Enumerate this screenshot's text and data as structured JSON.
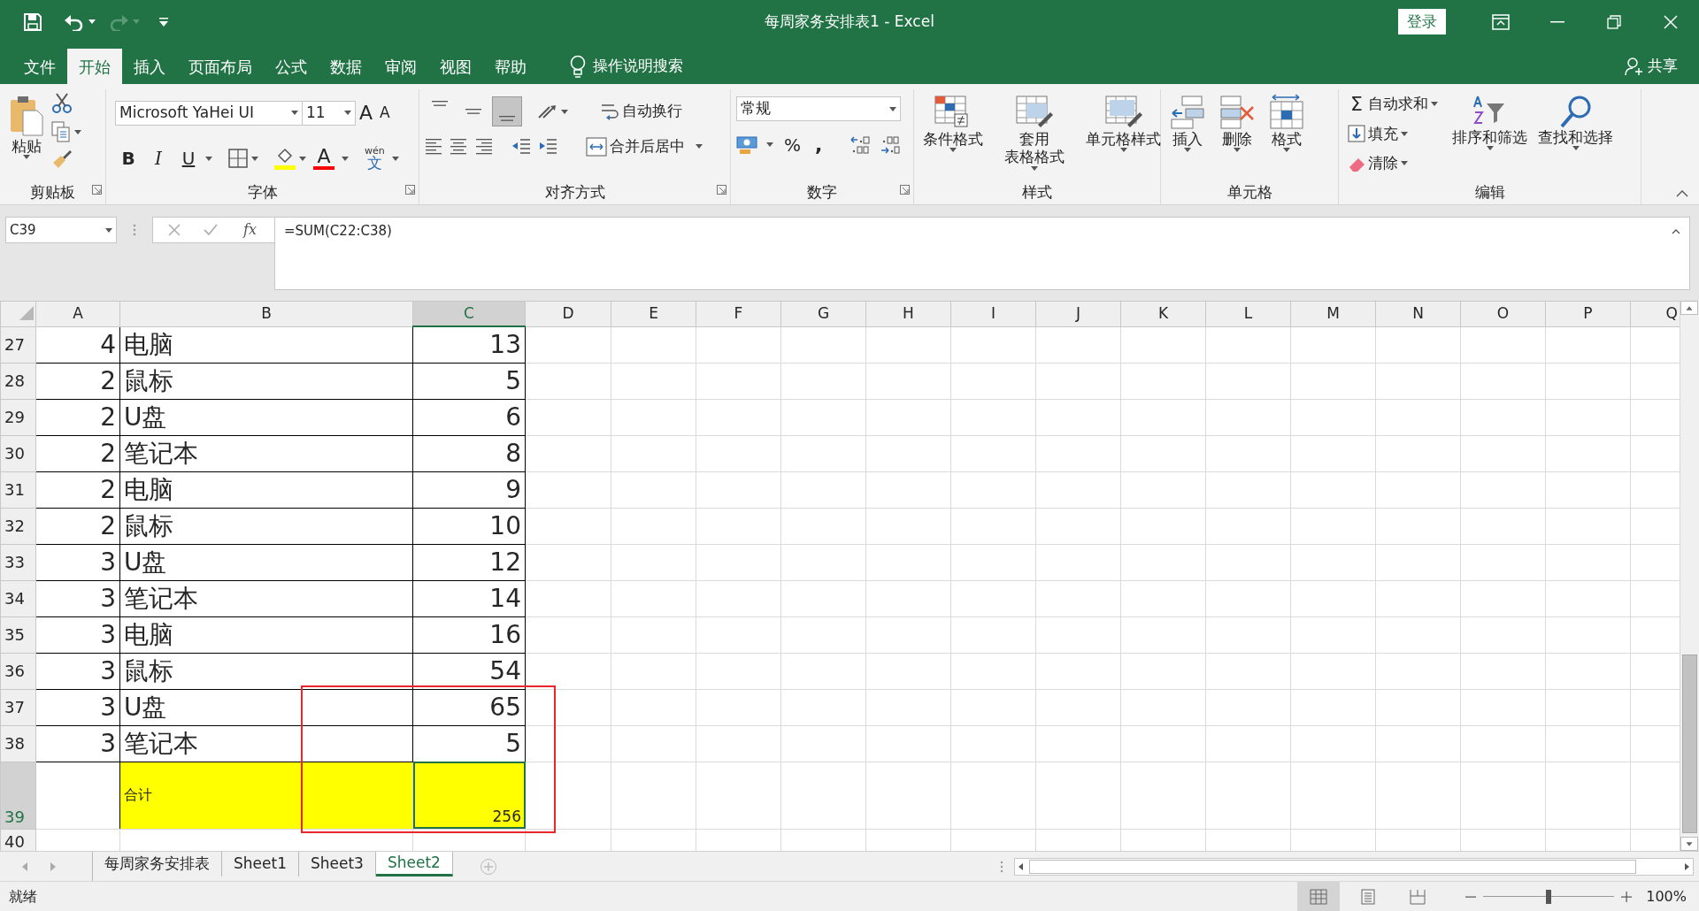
{
  "window": {
    "title": "每周家务安排表1  -  Excel",
    "sign_in": "登录",
    "share": "共享"
  },
  "menu_tabs": [
    {
      "label": "文件",
      "selected": false
    },
    {
      "label": "开始",
      "selected": true
    },
    {
      "label": "插入",
      "selected": false
    },
    {
      "label": "页面布局",
      "selected": false
    },
    {
      "label": "公式",
      "selected": false
    },
    {
      "label": "数据",
      "selected": false
    },
    {
      "label": "审阅",
      "selected": false
    },
    {
      "label": "视图",
      "selected": false
    },
    {
      "label": "帮助",
      "selected": false
    }
  ],
  "tell_me": "操作说明搜索",
  "ribbon": {
    "clipboard": {
      "label": "剪贴板",
      "paste": "粘贴"
    },
    "font": {
      "label": "字体",
      "name": "Microsoft YaHei UI",
      "size": "11",
      "grow": "A",
      "shrink": "A",
      "styles": [
        "B",
        "I",
        "U"
      ],
      "color_glyph": "A",
      "phonetic": [
        "wén",
        "文"
      ]
    },
    "alignment": {
      "label": "对齐方式",
      "wrap": "自动换行",
      "merge": "合并后居中",
      "vertical": [
        {
          "selected": false
        },
        {
          "selected": false
        },
        {
          "selected": true
        }
      ]
    },
    "number": {
      "label": "数字",
      "format": "常规",
      "percent": "%",
      "comma": ","
    },
    "styles": {
      "label": "样式",
      "buttons": [
        {
          "lines": [
            "条件格式"
          ]
        },
        {
          "lines": [
            "套用",
            "表格格式"
          ]
        },
        {
          "lines": [
            "单元格样式"
          ]
        }
      ]
    },
    "cells": {
      "label": "单元格",
      "buttons": [
        "插入",
        "删除",
        "格式"
      ]
    },
    "editing": {
      "label": "编辑",
      "sum_glyph": "Σ",
      "items": [
        "自动求和",
        "填充",
        "清除"
      ],
      "buttons": [
        "排序和筛选",
        "查找和选择"
      ]
    }
  },
  "formula_bar": {
    "name_box": "C39",
    "fx": "fx",
    "formula": "=SUM(C22:C38)"
  },
  "sheet": {
    "columns": [
      {
        "label": "A",
        "selected": false
      },
      {
        "label": "B",
        "selected": false
      },
      {
        "label": "C",
        "selected": true
      },
      {
        "label": "D",
        "selected": false
      },
      {
        "label": "E",
        "selected": false
      },
      {
        "label": "F",
        "selected": false
      },
      {
        "label": "G",
        "selected": false
      },
      {
        "label": "H",
        "selected": false
      },
      {
        "label": "I",
        "selected": false
      },
      {
        "label": "J",
        "selected": false
      },
      {
        "label": "K",
        "selected": false
      },
      {
        "label": "L",
        "selected": false
      },
      {
        "label": "M",
        "selected": false
      },
      {
        "label": "N",
        "selected": false
      },
      {
        "label": "O",
        "selected": false
      },
      {
        "label": "P",
        "selected": false
      },
      {
        "label": "Q",
        "selected": false
      }
    ],
    "rows": [
      {
        "number": "27",
        "kind": "item",
        "a": "4",
        "b": "电脑",
        "c": "13",
        "selected": false
      },
      {
        "number": "28",
        "kind": "item",
        "a": "2",
        "b": "鼠标",
        "c": "5",
        "selected": false
      },
      {
        "number": "29",
        "kind": "item",
        "a": "2",
        "b": "U盘",
        "c": "6",
        "selected": false
      },
      {
        "number": "30",
        "kind": "item",
        "a": "2",
        "b": "笔记本",
        "c": "8",
        "selected": false
      },
      {
        "number": "31",
        "kind": "item",
        "a": "2",
        "b": "电脑",
        "c": "9",
        "selected": false
      },
      {
        "number": "32",
        "kind": "item",
        "a": "2",
        "b": "鼠标",
        "c": "10",
        "selected": false
      },
      {
        "number": "33",
        "kind": "item",
        "a": "3",
        "b": "U盘",
        "c": "12",
        "selected": false
      },
      {
        "number": "34",
        "kind": "item",
        "a": "3",
        "b": "笔记本",
        "c": "14",
        "selected": false
      },
      {
        "number": "35",
        "kind": "item",
        "a": "3",
        "b": "电脑",
        "c": "16",
        "selected": false
      },
      {
        "number": "36",
        "kind": "item",
        "a": "3",
        "b": "鼠标",
        "c": "54",
        "selected": false
      },
      {
        "number": "37",
        "kind": "item",
        "a": "3",
        "b": "U盘",
        "c": "65",
        "selected": false
      },
      {
        "number": "38",
        "kind": "item",
        "a": "3",
        "b": "笔记本",
        "c": "5",
        "selected": false
      },
      {
        "number": "39",
        "kind": "total",
        "b": "合计",
        "c": "256",
        "selected": true
      },
      {
        "number": "40",
        "kind": "empty",
        "selected": false
      }
    ],
    "highlight_box": true
  },
  "sheet_tabs": [
    {
      "label": "每周家务安排表",
      "selected": false
    },
    {
      "label": "Sheet1",
      "selected": false
    },
    {
      "label": "Sheet3",
      "selected": false
    },
    {
      "label": "Sheet2",
      "selected": true
    }
  ],
  "status_bar": {
    "status": "就绪",
    "views": [
      {
        "kind": "normal",
        "selected": true
      },
      {
        "kind": "page_layout",
        "selected": false
      },
      {
        "kind": "page_break",
        "selected": false
      }
    ],
    "zoom": {
      "level": 0.5,
      "reading": "100%"
    }
  }
}
